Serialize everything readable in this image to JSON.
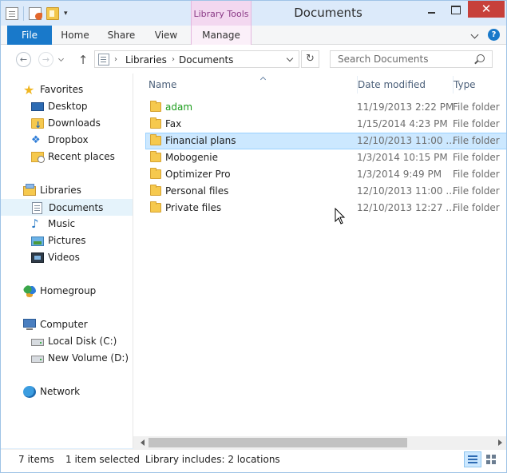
{
  "window": {
    "title": "Documents",
    "close_glyph": "✕"
  },
  "ribbon": {
    "context_group": "Library Tools",
    "tabs": {
      "file": "File",
      "home": "Home",
      "share": "Share",
      "view": "View",
      "manage": "Manage"
    },
    "help_glyph": "?"
  },
  "nav": {
    "back_glyph": "←",
    "forward_glyph": "→",
    "up_glyph": "↑",
    "refresh_glyph": "↻",
    "crumb_separator": "›",
    "breadcrumb": [
      "Libraries",
      "Documents"
    ],
    "search_placeholder": "Search Documents"
  },
  "navpane": {
    "favorites": "Favorites",
    "desktop": "Desktop",
    "downloads": "Downloads",
    "dropbox": "Dropbox",
    "recent_places": "Recent places",
    "libraries": "Libraries",
    "documents": "Documents",
    "music": "Music",
    "pictures": "Pictures",
    "videos": "Videos",
    "homegroup": "Homegroup",
    "computer": "Computer",
    "local_disk": "Local Disk (C:)",
    "new_volume": "New Volume (D:)",
    "network": "Network",
    "glyphs": {
      "star": "★",
      "dropbox": "❖",
      "music": "♪"
    }
  },
  "columns": {
    "name": "Name",
    "date": "Date modified",
    "type": "Type"
  },
  "files": [
    {
      "name": "adam",
      "date": "11/19/2013 2:22 PM",
      "type": "File folder",
      "name_color": "#1a9c1a"
    },
    {
      "name": "Fax",
      "date": "1/15/2014 4:23 PM",
      "type": "File folder"
    },
    {
      "name": "Financial plans",
      "date": "12/10/2013 11:00 ...",
      "type": "File folder"
    },
    {
      "name": "Mobogenie",
      "date": "1/3/2014 10:15 PM",
      "type": "File folder"
    },
    {
      "name": "Optimizer Pro",
      "date": "1/3/2014 9:49 PM",
      "type": "File folder"
    },
    {
      "name": "Personal files",
      "date": "12/10/2013 11:00 ...",
      "type": "File folder"
    },
    {
      "name": "Private files",
      "date": "12/10/2013 12:27 ...",
      "type": "File folder"
    }
  ],
  "status": {
    "item_count": "7 items",
    "selected": "1 item selected",
    "library": "Library includes: 2 locations"
  },
  "colors": {
    "accent": "#1979ca",
    "selection_fill": "#cce8ff",
    "selection_border": "#99d1ff",
    "close_button": "#c7403a",
    "context_tab": "#f3d8f0"
  }
}
